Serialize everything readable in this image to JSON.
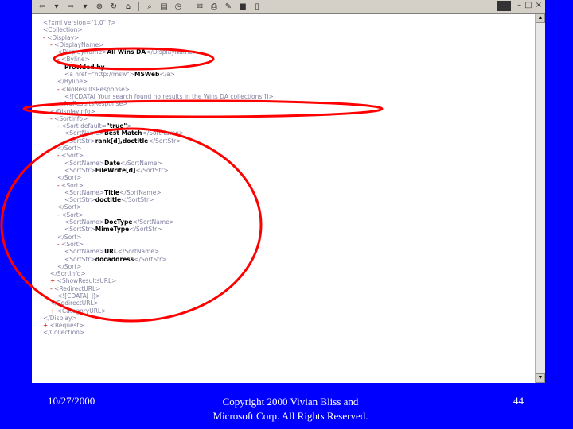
{
  "toolbar": {
    "icons": [
      "back-icon",
      "dropdown-icon",
      "forward-icon",
      "dropdown-icon",
      "stop-icon",
      "refresh-icon",
      "home-icon",
      "search-icon",
      "favorites-icon",
      "history-icon",
      "mail-icon",
      "print-icon",
      "edit-icon",
      "discuss-icon",
      "messenger-icon"
    ]
  },
  "xml_lines": [
    {
      "indent": 0,
      "prefix": "",
      "text": "<?xml version=\"1.0\" ?>",
      "bold": ""
    },
    {
      "indent": 0,
      "prefix": "",
      "text": "<Collection>",
      "bold": ""
    },
    {
      "indent": 0,
      "prefix": "- ",
      "text": "<Display>",
      "bold": ""
    },
    {
      "indent": 1,
      "prefix": "- ",
      "text": "<DisplayName>",
      "bold": ""
    },
    {
      "indent": 2,
      "prefix": "",
      "text": "<DisplayName>",
      "bold": "All Wins DA",
      "after": "</DisplayName>"
    },
    {
      "indent": 2,
      "prefix": "- ",
      "text": "<Byline>",
      "bold": ""
    },
    {
      "indent": 3,
      "prefix": "",
      "text": "",
      "bold": "Provided by"
    },
    {
      "indent": 3,
      "prefix": "",
      "text": "<a href=\"http://msw\">",
      "bold": "MSWeb",
      "after": "</a>"
    },
    {
      "indent": 2,
      "prefix": "",
      "text": "</Byline>",
      "bold": ""
    },
    {
      "indent": 2,
      "prefix": "- ",
      "text": "<NoResultsResponse>",
      "bold": ""
    },
    {
      "indent": 3,
      "prefix": "",
      "text": "<![CDATA[ Your search found no results in the Wins DA collections.]]>",
      "bold": ""
    },
    {
      "indent": 2,
      "prefix": "",
      "text": "</NoResultsResponse>",
      "bold": ""
    },
    {
      "indent": 1,
      "prefix": "",
      "text": "</DisplayInfo>",
      "bold": ""
    },
    {
      "indent": 1,
      "prefix": "- ",
      "text": "<SortInfo>",
      "bold": ""
    },
    {
      "indent": 2,
      "prefix": "- ",
      "text": "<Sort default=",
      "bold": "\"true\"",
      "after": ">"
    },
    {
      "indent": 3,
      "prefix": "",
      "text": "<SortName>",
      "bold": "Best Match",
      "after": "</SortName>"
    },
    {
      "indent": 3,
      "prefix": "",
      "text": "<SortStr>",
      "bold": "rank[d],doctitle",
      "after": "</SortStr>"
    },
    {
      "indent": 2,
      "prefix": "",
      "text": "</Sort>",
      "bold": ""
    },
    {
      "indent": 2,
      "prefix": "- ",
      "text": "<Sort>",
      "bold": ""
    },
    {
      "indent": 3,
      "prefix": "",
      "text": "<SortName>",
      "bold": "Date",
      "after": "</SortName>"
    },
    {
      "indent": 3,
      "prefix": "",
      "text": "<SortStr>",
      "bold": "FileWrite[d]",
      "after": "</SortStr>"
    },
    {
      "indent": 2,
      "prefix": "",
      "text": "</Sort>",
      "bold": ""
    },
    {
      "indent": 2,
      "prefix": "- ",
      "text": "<Sort>",
      "bold": ""
    },
    {
      "indent": 3,
      "prefix": "",
      "text": "<SortName>",
      "bold": "Title",
      "after": "</SortName>"
    },
    {
      "indent": 3,
      "prefix": "",
      "text": "<SortStr>",
      "bold": "doctitle",
      "after": "</SortStr>"
    },
    {
      "indent": 2,
      "prefix": "",
      "text": "</Sort>",
      "bold": ""
    },
    {
      "indent": 2,
      "prefix": "- ",
      "text": "<Sort>",
      "bold": ""
    },
    {
      "indent": 3,
      "prefix": "",
      "text": "<SortName>",
      "bold": "DocType",
      "after": "</SortName>"
    },
    {
      "indent": 3,
      "prefix": "",
      "text": "<SortStr>",
      "bold": "MimeType",
      "after": "</SortStr>"
    },
    {
      "indent": 2,
      "prefix": "",
      "text": "</Sort>",
      "bold": ""
    },
    {
      "indent": 2,
      "prefix": "- ",
      "text": "<Sort>",
      "bold": ""
    },
    {
      "indent": 3,
      "prefix": "",
      "text": "<SortName>",
      "bold": "URL",
      "after": "</SortName>"
    },
    {
      "indent": 3,
      "prefix": "",
      "text": "<SortStr>",
      "bold": "docaddress",
      "after": "</SortStr>"
    },
    {
      "indent": 2,
      "prefix": "",
      "text": "</Sort>",
      "bold": ""
    },
    {
      "indent": 1,
      "prefix": "",
      "text": "</SortInfo>",
      "bold": ""
    },
    {
      "indent": 1,
      "prefix": "+ ",
      "text": "<ShowResultsURL>",
      "bold": ""
    },
    {
      "indent": 1,
      "prefix": "- ",
      "text": "<RedirectURL>",
      "bold": ""
    },
    {
      "indent": 2,
      "prefix": "",
      "text": "<![CDATA[ ]]>",
      "bold": ""
    },
    {
      "indent": 1,
      "prefix": "",
      "text": "</RedirectURL>",
      "bold": ""
    },
    {
      "indent": 1,
      "prefix": "+ ",
      "text": "<CategoryURL>",
      "bold": ""
    },
    {
      "indent": 0,
      "prefix": "",
      "text": "</Display>",
      "bold": ""
    },
    {
      "indent": 0,
      "prefix": "+ ",
      "text": "<Request>",
      "bold": ""
    },
    {
      "indent": 0,
      "prefix": "",
      "text": "</Collection>",
      "bold": ""
    }
  ],
  "footer": {
    "date": "10/27/2000",
    "copyright_line1": "Copyright 2000 Vivian Bliss and",
    "copyright_line2": "Microsoft Corp. All Rights Reserved.",
    "page_number": "44"
  },
  "colors": {
    "background": "#0000ff",
    "highlight": "#ff0000"
  }
}
